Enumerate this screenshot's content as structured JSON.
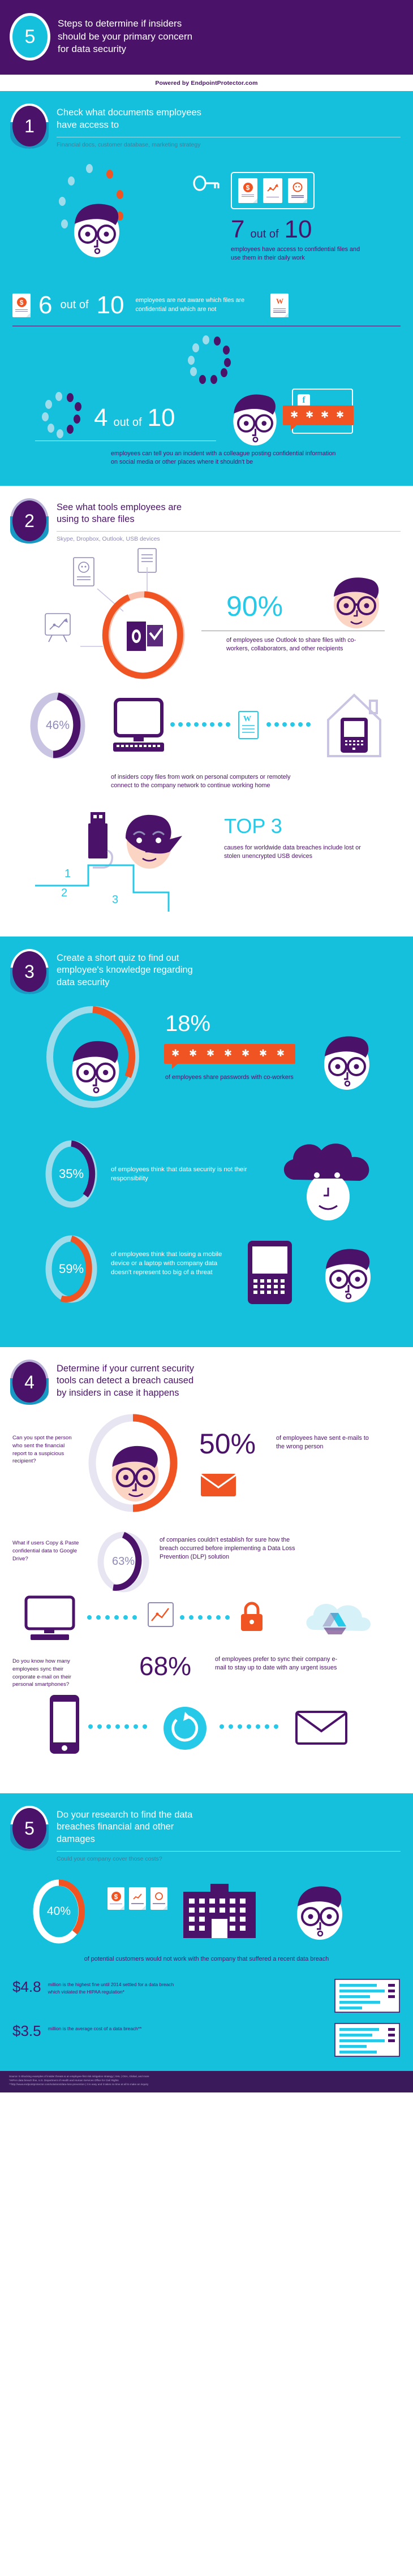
{
  "header": {
    "number": "5",
    "title_lines": [
      "Steps to determine if insiders",
      "should be your primary concern",
      "for data security"
    ],
    "powered_by": "Powered by EndpointProtector.com",
    "colors": {
      "purple": "#4b1269",
      "teal": "#15c0dd",
      "orange": "#f05423",
      "cyan": "#26c9e8",
      "lavender": "#8f8ab8"
    }
  },
  "sections": [
    {
      "number": "1",
      "title_lines": [
        "Check what documents employees",
        "have access to"
      ],
      "subtitle": "Financial docs, customer database, marketing strategy",
      "theme": "teal",
      "stats": [
        {
          "value": "7",
          "mid": "out of",
          "total": "10",
          "desc": "employees have access to confidential files and use them in their daily work",
          "icons": [
            "key-icon",
            "dollar-document-icon",
            "chart-board-icon",
            "id-photo-document-icon"
          ]
        },
        {
          "value": "6",
          "mid": "out of",
          "total": "10",
          "desc": "employees are not aware which files are confidential and which are not",
          "icons": [
            "dollar-document-icon",
            "word-document-icon"
          ]
        },
        {
          "value": "4",
          "mid": "out of",
          "total": "10",
          "desc": "employees can tell you an incident with a colleague posting confidential information on social media or other places where it shouldn't be",
          "icons": [
            "facebook-icon",
            "password-bubble-icon"
          ],
          "password_mask": "✱ ✱ ✱ ✱"
        }
      ]
    },
    {
      "number": "2",
      "title_lines": [
        "See what tools employees are",
        "using to share files"
      ],
      "subtitle": "Skype, Dropbox, Outlook, USB devices",
      "theme": "white",
      "stats": [
        {
          "value": "90%",
          "desc": "of employees use Outlook to share files with co-workers, collaborators, and other recipients",
          "donut_pct": 90,
          "icons": [
            "outlook-icon",
            "word-document-icon",
            "id-photo-document-icon",
            "chart-board-icon"
          ]
        },
        {
          "value": "46%",
          "desc": "of insiders copy files from work on personal computers or remotely connect to the company network to continue working home",
          "donut_pct": 46,
          "icons": [
            "desktop-computer-icon",
            "word-document-icon",
            "home-laptop-icon"
          ]
        },
        {
          "value": "TOP 3",
          "desc": "causes for worldwide data breaches include lost or stolen unencrypted USB devices",
          "icons": [
            "usb-stick-icon",
            "thief-face-icon"
          ],
          "step_labels": [
            "2",
            "1",
            "3"
          ]
        }
      ]
    },
    {
      "number": "3",
      "title_lines": [
        "Create a short quiz to find out",
        "employee's knowledge regarding",
        "data security"
      ],
      "subtitle": "",
      "theme": "teal",
      "stats": [
        {
          "value": "18%",
          "desc": "of employees share passwords with co-workers",
          "donut_pct": 18,
          "password_mask": "✱ ✱ ✱ ✱ ✱ ✱ ✱",
          "icons": [
            "password-bubble-icon",
            "face-icon"
          ]
        },
        {
          "value": "35%",
          "desc": "of employees think that data security is not their responsibility",
          "donut_pct": 35,
          "icons": [
            "cloud-face-icon"
          ]
        },
        {
          "value": "59%",
          "desc": "of employees think that losing a mobile device or a laptop with company data doesn't represent too big of a threat",
          "donut_pct": 59,
          "icons": [
            "tablet-icon",
            "face-icon"
          ]
        }
      ]
    },
    {
      "number": "4",
      "title_lines": [
        "Determine if your current security",
        "tools can detect a breach caused",
        "by insiders in case it happens"
      ],
      "subtitle": "",
      "theme": "white",
      "stats": [
        {
          "question": "Can you spot the person who sent the financial report to a suspicious recipient?",
          "value": "50%",
          "desc": "of employees have sent e-mails to the wrong person",
          "donut_pct": 50,
          "icons": [
            "face-icon",
            "envelope-icon"
          ]
        },
        {
          "question": "What if users Copy & Paste confidential data to Google Drive?",
          "value": "63%",
          "desc": "of companies couldn't establish for sure how the breach occurred before implementing a Data Loss Prevention (DLP) solution",
          "donut_pct": 63,
          "icons": [
            "monitor-icon",
            "chart-icon",
            "lock-icon",
            "google-drive-icon"
          ]
        },
        {
          "question": "Do you know how many employees sync their corporate e-mail on their personal smartphones?",
          "value": "68%",
          "desc": "of employees prefer to sync their company e-mail to stay up to date with any urgent issues",
          "donut_pct": 68,
          "icons": [
            "smartphone-icon",
            "sync-icon",
            "envelope-icon"
          ]
        }
      ]
    },
    {
      "number": "5",
      "title_lines": [
        "Do your research to find the data",
        "breaches financial and other",
        "damages"
      ],
      "subtitle": "Could your company cover those costs?",
      "theme": "teal",
      "stats": [
        {
          "value": "40%",
          "desc": "of potential customers would not work with the company that suffered a recent data breach",
          "donut_pct": 40,
          "icons": [
            "document-icon",
            "building-icon",
            "face-icon"
          ]
        }
      ],
      "money_rows": [
        {
          "amount": "$4.8",
          "text": "million is the highest fine until 2014 settled for a data breach which violated the HIPAA regulation*",
          "icon": "document-bars-icon"
        },
        {
          "amount": "$3.5",
          "text": "million is the average cost of a data breach**",
          "icon": "document-bars-icon"
        }
      ]
    }
  ],
  "footer": {
    "lines": [
      "Source: 5 Shocking examples of insider threats & an employee-first risk mitigation strategy | SHL | OSA, Global, and more",
      "*HIPAA data breach fine, U.S. Department of Health and Human Services Office for Civil Rights",
      "**http://www.endpointprotector.com/solutions/data-loss-prevention | it is easy and it takes no time at all to make an inquiry"
    ]
  }
}
